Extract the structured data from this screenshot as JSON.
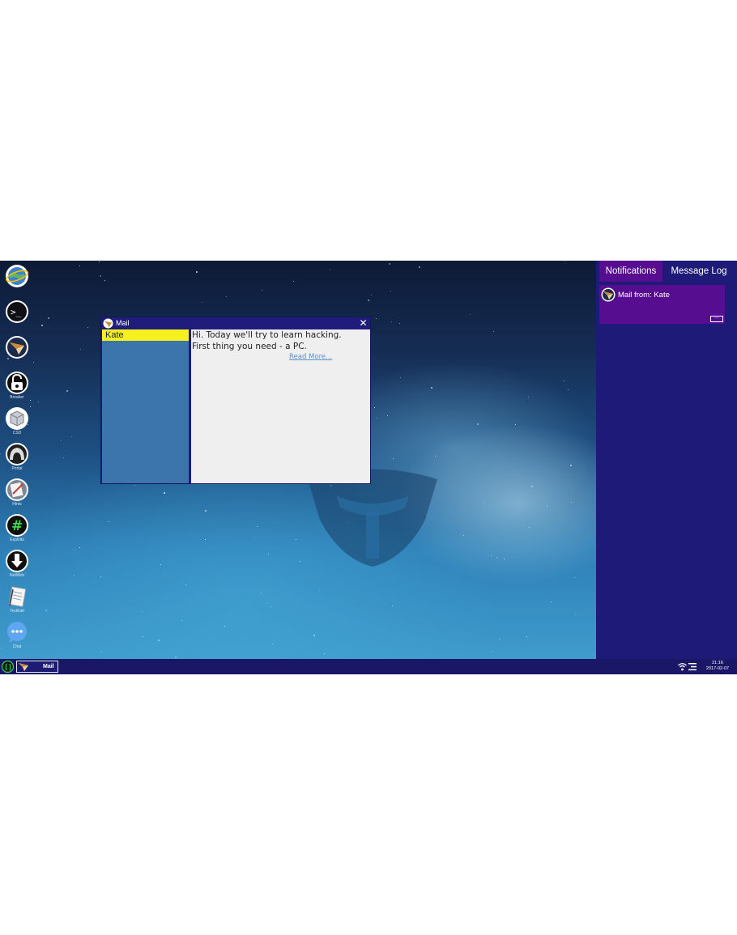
{
  "desktop": {
    "icons": [
      {
        "name": "globe-icon",
        "label": ""
      },
      {
        "name": "terminal-icon",
        "label": ""
      },
      {
        "name": "mail-icon",
        "label": ""
      },
      {
        "name": "unlock-icon",
        "label": "Breaker"
      },
      {
        "name": "cube-icon",
        "label": "CSD"
      },
      {
        "name": "hood-icon",
        "label": "Portal"
      },
      {
        "name": "notes-icon",
        "label": "Hints"
      },
      {
        "name": "hash-icon",
        "label": "Exploits"
      },
      {
        "name": "download-icon",
        "label": "NetWeb"
      },
      {
        "name": "notepad-icon",
        "label": "TextEdit"
      },
      {
        "name": "chat-icon",
        "label": "Chat"
      }
    ]
  },
  "mail_window": {
    "title": "Mail",
    "close_glyph": "✕",
    "senders": [
      {
        "name": "Kate",
        "selected": true
      }
    ],
    "message": {
      "lines": [
        "Hi. Today we'll try to learn hacking.",
        "First thing you need - a PC."
      ],
      "read_more": "Read More..."
    }
  },
  "notifications_panel": {
    "tabs": [
      {
        "label": "Notifications",
        "active": true
      },
      {
        "label": "Message Log",
        "active": false
      }
    ],
    "items": [
      {
        "text": "Mail from: Kate",
        "more": "···"
      }
    ]
  },
  "taskbar": {
    "tasks": [
      {
        "label": "Mail"
      }
    ],
    "clock": {
      "time": "21:16",
      "date": "2017-02-07"
    }
  },
  "colors": {
    "panel": "#1d1a78",
    "accent_purple": "#560d90",
    "selected_sender": "#f7f01f",
    "sender_list": "#3c74ac",
    "message_bg": "#efefef"
  }
}
